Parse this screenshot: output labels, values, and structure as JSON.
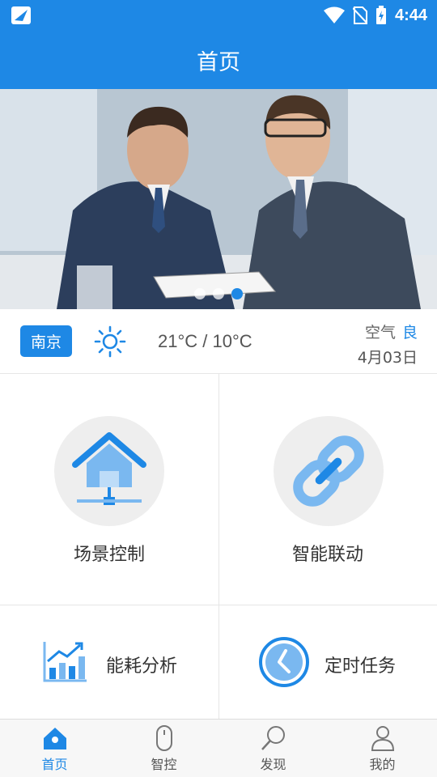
{
  "status_bar": {
    "time": "4:44"
  },
  "header": {
    "title": "首页"
  },
  "banner": {
    "slides": 3,
    "active_slide": 3
  },
  "weather": {
    "city": "南京",
    "icon": "sun-icon",
    "temperature": "21°C / 10°C",
    "air_label": "空气",
    "air_quality": "良",
    "date": "4月03日"
  },
  "features": [
    {
      "label": "场景控制",
      "icon": "home-network-icon"
    },
    {
      "label": "智能联动",
      "icon": "link-icon"
    },
    {
      "label": "能耗分析",
      "icon": "chart-icon"
    },
    {
      "label": "定时任务",
      "icon": "clock-icon"
    }
  ],
  "tabs": [
    {
      "label": "首页",
      "icon": "home-icon",
      "active": true
    },
    {
      "label": "智控",
      "icon": "mouse-icon",
      "active": false
    },
    {
      "label": "发现",
      "icon": "search-icon",
      "active": false
    },
    {
      "label": "我的",
      "icon": "person-icon",
      "active": false
    }
  ],
  "colors": {
    "primary": "#1e88e5",
    "icon_light": "#6fb3f2"
  }
}
